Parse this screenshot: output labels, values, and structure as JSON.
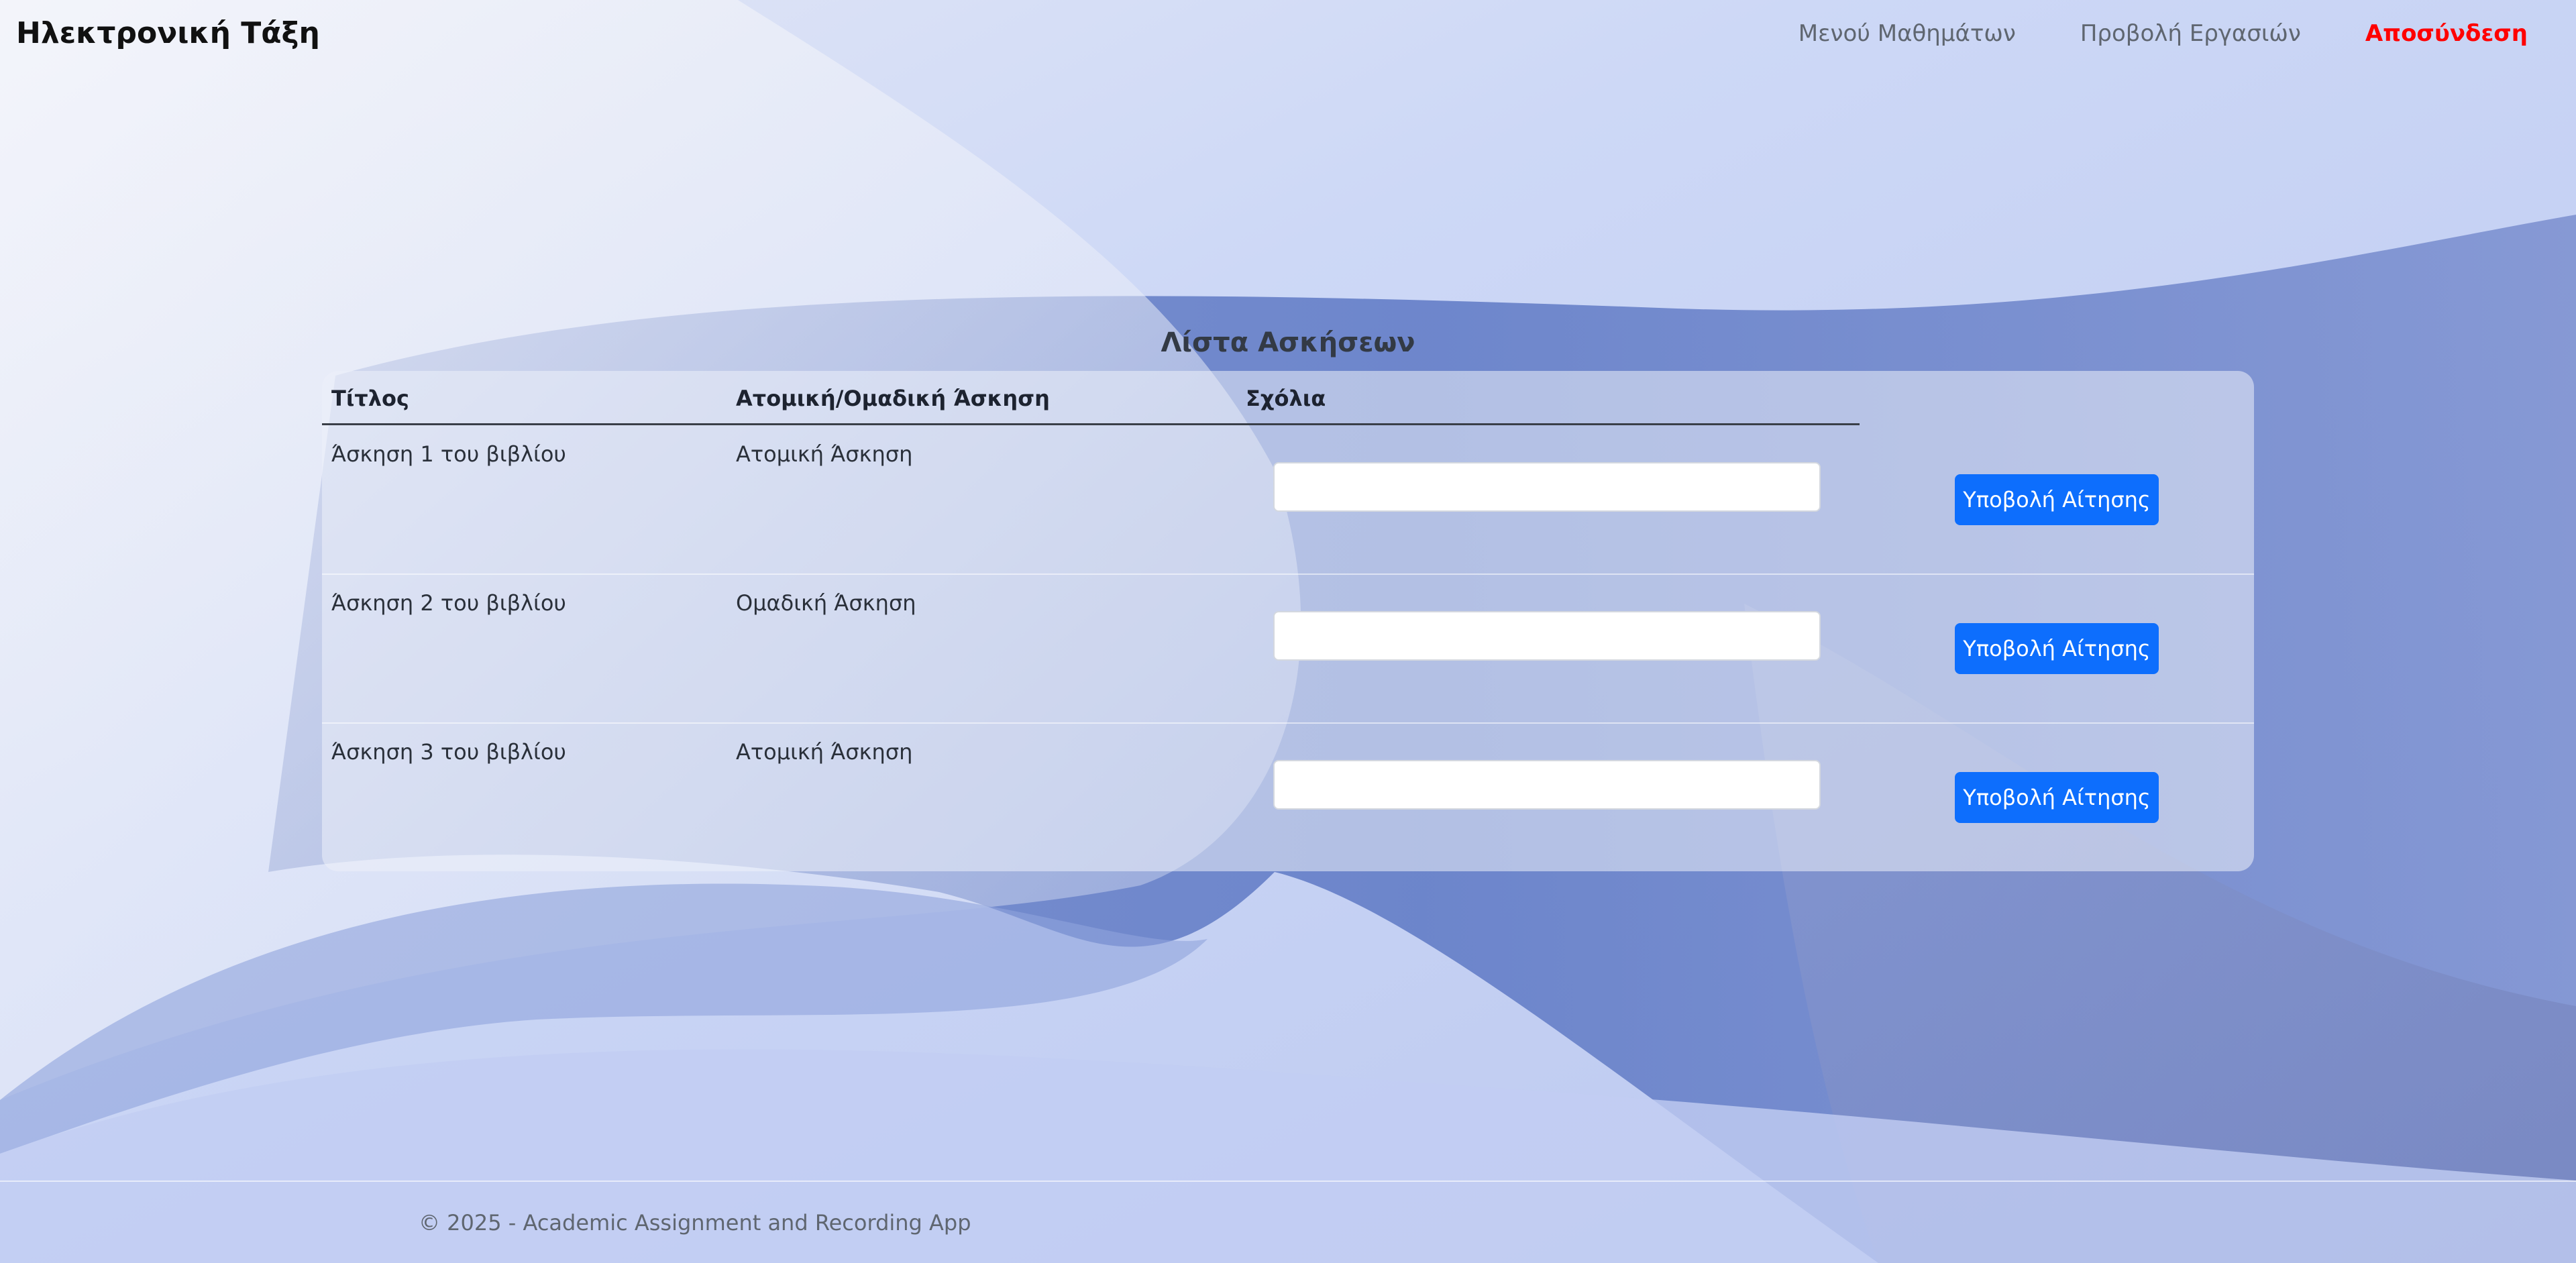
{
  "navbar": {
    "brand": "Ηλεκτρονική Τάξη",
    "links": [
      {
        "label": "Μενού Μαθημάτων"
      },
      {
        "label": "Προβολή Εργασιών"
      },
      {
        "label": "Αποσύνδεση"
      }
    ]
  },
  "main": {
    "title": "Λίστα Ασκήσεων",
    "table": {
      "headers": [
        "Τίτλος",
        "Ατομική/Ομαδική Άσκηση",
        "Σχόλια"
      ],
      "rows": [
        {
          "title": "Άσκηση 1 του βιβλίου",
          "type": "Ατομική Άσκηση",
          "comment": "",
          "button": "Υποβολή Αίτησης"
        },
        {
          "title": "Άσκηση 2 του βιβλίου",
          "type": "Ομαδική Άσκηση",
          "comment": "",
          "button": "Υποβολή Αίτησης"
        },
        {
          "title": "Άσκηση 3 του βιβλίου",
          "type": "Ατομική Άσκηση",
          "comment": "",
          "button": "Υποβολή Αίτησης"
        }
      ]
    }
  },
  "footer": {
    "text": "© 2025 - Academic Assignment and Recording App"
  },
  "colors": {
    "primary_button": "#0d6efd",
    "logout": "#ff0000",
    "background": "#c7d3f4"
  }
}
